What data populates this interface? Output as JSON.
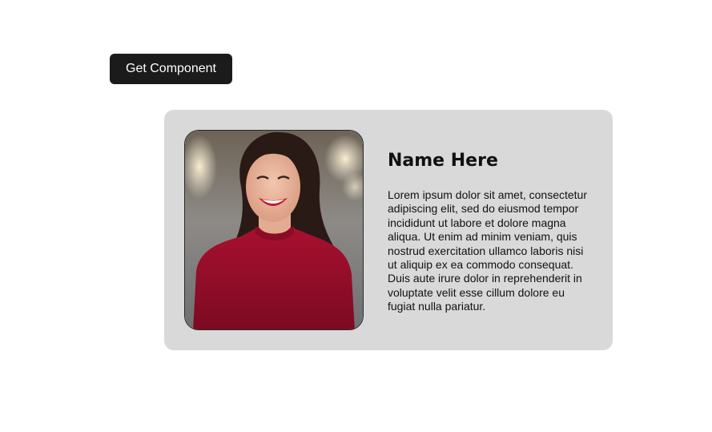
{
  "toolbar": {
    "get_component_label": "Get Component"
  },
  "card": {
    "name": "Name Here",
    "description": "Lorem ipsum dolor sit amet, consectetur adipiscing elit, sed do eiusmod tempor incididunt ut labore et dolore magna aliqua. Ut enim ad minim veniam, quis nostrud exercitation ullamco laboris nisi ut aliquip ex ea commodo consequat. Duis aute irure dolor in reprehenderit in voluptate velit esse cillum dolore eu fugiat nulla pariatur.",
    "photo": "profile-photo-smiling-woman-red-sweater"
  },
  "colors": {
    "button_bg": "#1b1b1b",
    "card_bg": "#d9d9d9",
    "sweater": "#9b0f2a"
  }
}
